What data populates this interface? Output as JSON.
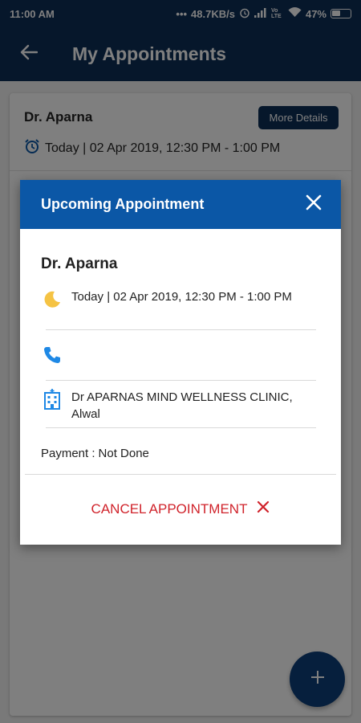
{
  "status_bar": {
    "time": "11:00 AM",
    "dots": "•••",
    "network_speed": "48.7KB/s",
    "volte": "Vo LTE",
    "battery": "47%"
  },
  "app_bar": {
    "title": "My Appointments",
    "back_icon": "arrow-left-icon"
  },
  "appointment_card": {
    "doctor": "Dr. Aparna",
    "more_details_label": "More Details",
    "when": "Today | 02 Apr 2019, 12:30 PM - 1:00 PM",
    "clock_icon": "alarm-clock-icon"
  },
  "fab": {
    "icon": "plus-icon",
    "label": "+"
  },
  "dialog": {
    "title": "Upcoming Appointment",
    "close_icon": "close-icon",
    "doctor": "Dr. Aparna",
    "when": "Today | 02 Apr 2019, 12:30 PM - 1:00 PM",
    "phone": "",
    "clinic": "Dr APARNAS MIND WELLNESS CLINIC, Alwal",
    "payment_label": "Payment :",
    "payment_value": "Not Done",
    "cancel_label": "CANCEL APPOINTMENT",
    "cancel_icon": "close-icon"
  },
  "colors": {
    "primary_dark": "#0d2e57",
    "dialog_header": "#0b57a6",
    "cancel_red": "#d0232b",
    "icon_blue": "#1e88e5",
    "moon_yellow": "#f5c344"
  }
}
